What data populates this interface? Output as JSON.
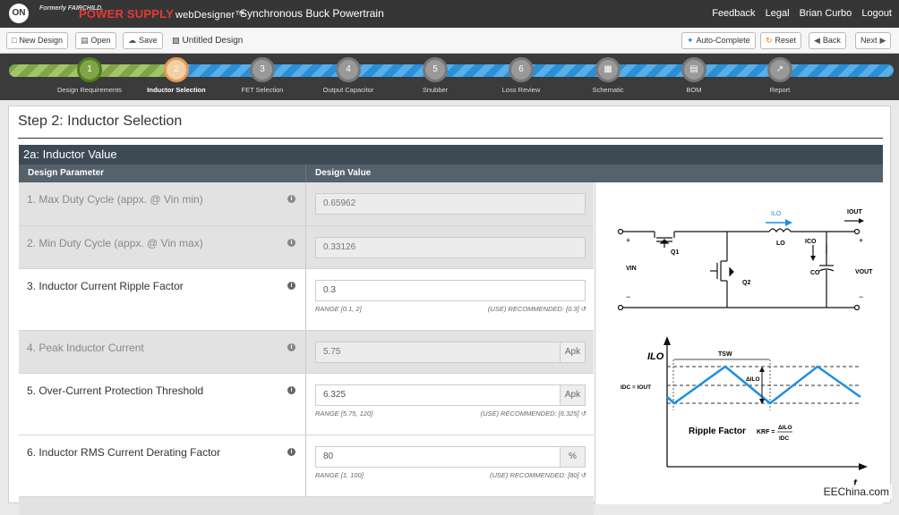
{
  "header": {
    "logo_on": "ON",
    "logo_fairchild": "Formerly FAIRCHILD.",
    "brand": "POWER SUPPLY",
    "brand_sub": "webDesigner™",
    "title": "Synchronous Buck Powertrain",
    "links": [
      "Feedback",
      "Legal",
      "Brian Curbo",
      "Logout"
    ]
  },
  "toolbar": {
    "new_label": "New Design",
    "open_label": "Open",
    "save_label": "Save",
    "design_name": "Untitled Design",
    "autocomplete_label": "Auto-Complete",
    "reset_label": "Reset",
    "back_label": "Back",
    "next_label": "Next"
  },
  "wizard": {
    "steps": [
      {
        "num": "1",
        "label": "Design Requirements",
        "state": "done"
      },
      {
        "num": "2",
        "label": "Inductor Selection",
        "state": "current"
      },
      {
        "num": "3",
        "label": "FET Selection",
        "state": "todo"
      },
      {
        "num": "4",
        "label": "Output Capacitor",
        "state": "todo"
      },
      {
        "num": "5",
        "label": "Snubber",
        "state": "todo"
      },
      {
        "num": "6",
        "label": "Loss Review",
        "state": "todo"
      },
      {
        "num": "",
        "label": "Schematic",
        "state": "todo"
      },
      {
        "num": "",
        "label": "BOM",
        "state": "todo"
      },
      {
        "num": "",
        "label": "Report",
        "state": "todo"
      }
    ]
  },
  "page": {
    "title": "Step 2: Inductor Selection",
    "section_title": "2a: Inductor Value",
    "col_param": "Design Parameter",
    "col_value": "Design Value"
  },
  "params": [
    {
      "label": "1. Max Duty Cycle (appx. @ Vin min)",
      "value": "0.65962",
      "unit": "",
      "range": "",
      "recommended": "",
      "readonly": true
    },
    {
      "label": "2. Min Duty Cycle (appx. @ Vin max)",
      "value": "0.33126",
      "unit": "",
      "range": "",
      "recommended": "",
      "readonly": true
    },
    {
      "label": "3. Inductor Current Ripple Factor",
      "value": "0.3",
      "unit": "",
      "range": "RANGE [0.1, 2]",
      "recommended": "(USE) RECOMMENDED: [0.3]",
      "readonly": false
    },
    {
      "label": "4. Peak Inductor Current",
      "value": "5.75",
      "unit": "Apk",
      "range": "",
      "recommended": "",
      "readonly": true
    },
    {
      "label": "5. Over-Current Protection Threshold",
      "value": "6.325",
      "unit": "Apk",
      "range": "RANGE [5.75, 120]",
      "recommended": "(USE) RECOMMENDED: [6.325]",
      "readonly": false
    },
    {
      "label": "6. Inductor RMS Current Derating Factor",
      "value": "80",
      "unit": "%",
      "range": "RANGE [1, 100]",
      "recommended": "(USE) RECOMMENDED: [80]",
      "readonly": false
    }
  ],
  "schematic": {
    "i_lo": "ILO",
    "i_out": "IOUT",
    "l_o": "LO",
    "i_co": "ICO",
    "c_o": "CO",
    "v_in": "VIN",
    "v_out": "VOUT",
    "q1": "Q1",
    "q2": "Q2",
    "plus": "+",
    "minus": "−"
  },
  "waveform": {
    "y_label": "ILO",
    "tsw": "TSW",
    "delta": "ΔILO",
    "idc": "IDC = IOUT",
    "ripple": "Ripple Factor",
    "krf": "KRF =",
    "frac_num": "ΔILO",
    "frac_den": "IDC",
    "t": "t"
  },
  "watermark": "EEChina.com",
  "colors": {
    "accent_green": "#7fa547",
    "current_step": "#f3cfa3",
    "track_blue": "#2b8fd6",
    "wave_blue": "#1e90e0"
  }
}
